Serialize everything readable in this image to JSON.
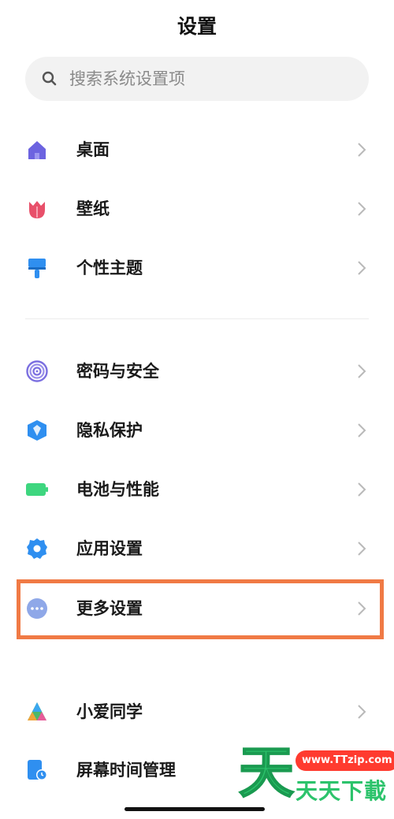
{
  "header": {
    "title": "设置"
  },
  "search": {
    "placeholder": "搜索系统设置项",
    "icon": "search-icon"
  },
  "groups": [
    {
      "items": [
        {
          "label": "桌面",
          "icon": "home-icon",
          "color": "#6c63e0"
        },
        {
          "label": "壁纸",
          "icon": "tulip-icon",
          "color": "#e8506a"
        },
        {
          "label": "个性主题",
          "icon": "paint-brush-icon",
          "color": "#2f8ff0"
        }
      ]
    },
    {
      "items": [
        {
          "label": "密码与安全",
          "icon": "fingerprint-icon",
          "color": "#7b6fe0"
        },
        {
          "label": "隐私保护",
          "icon": "privacy-shield-icon",
          "color": "#2f8ff0"
        },
        {
          "label": "电池与性能",
          "icon": "battery-icon",
          "color": "#3ed67f"
        },
        {
          "label": "应用设置",
          "icon": "gear-icon",
          "color": "#2f8ff0"
        },
        {
          "label": "更多设置",
          "icon": "more-dots-icon",
          "color": "#8fa8e8",
          "highlighted": true
        }
      ]
    },
    {
      "items": [
        {
          "label": "小爱同学",
          "icon": "xiaoai-icon",
          "color": "#4db86a"
        },
        {
          "label": "屏幕时间管理",
          "icon": "screen-time-icon",
          "color": "#2f8ff0"
        }
      ]
    }
  ],
  "highlight": {
    "color": "#f07a45"
  },
  "watermark": {
    "big_char": "天",
    "url": "www.TTzip.com",
    "text": "天天下載"
  }
}
